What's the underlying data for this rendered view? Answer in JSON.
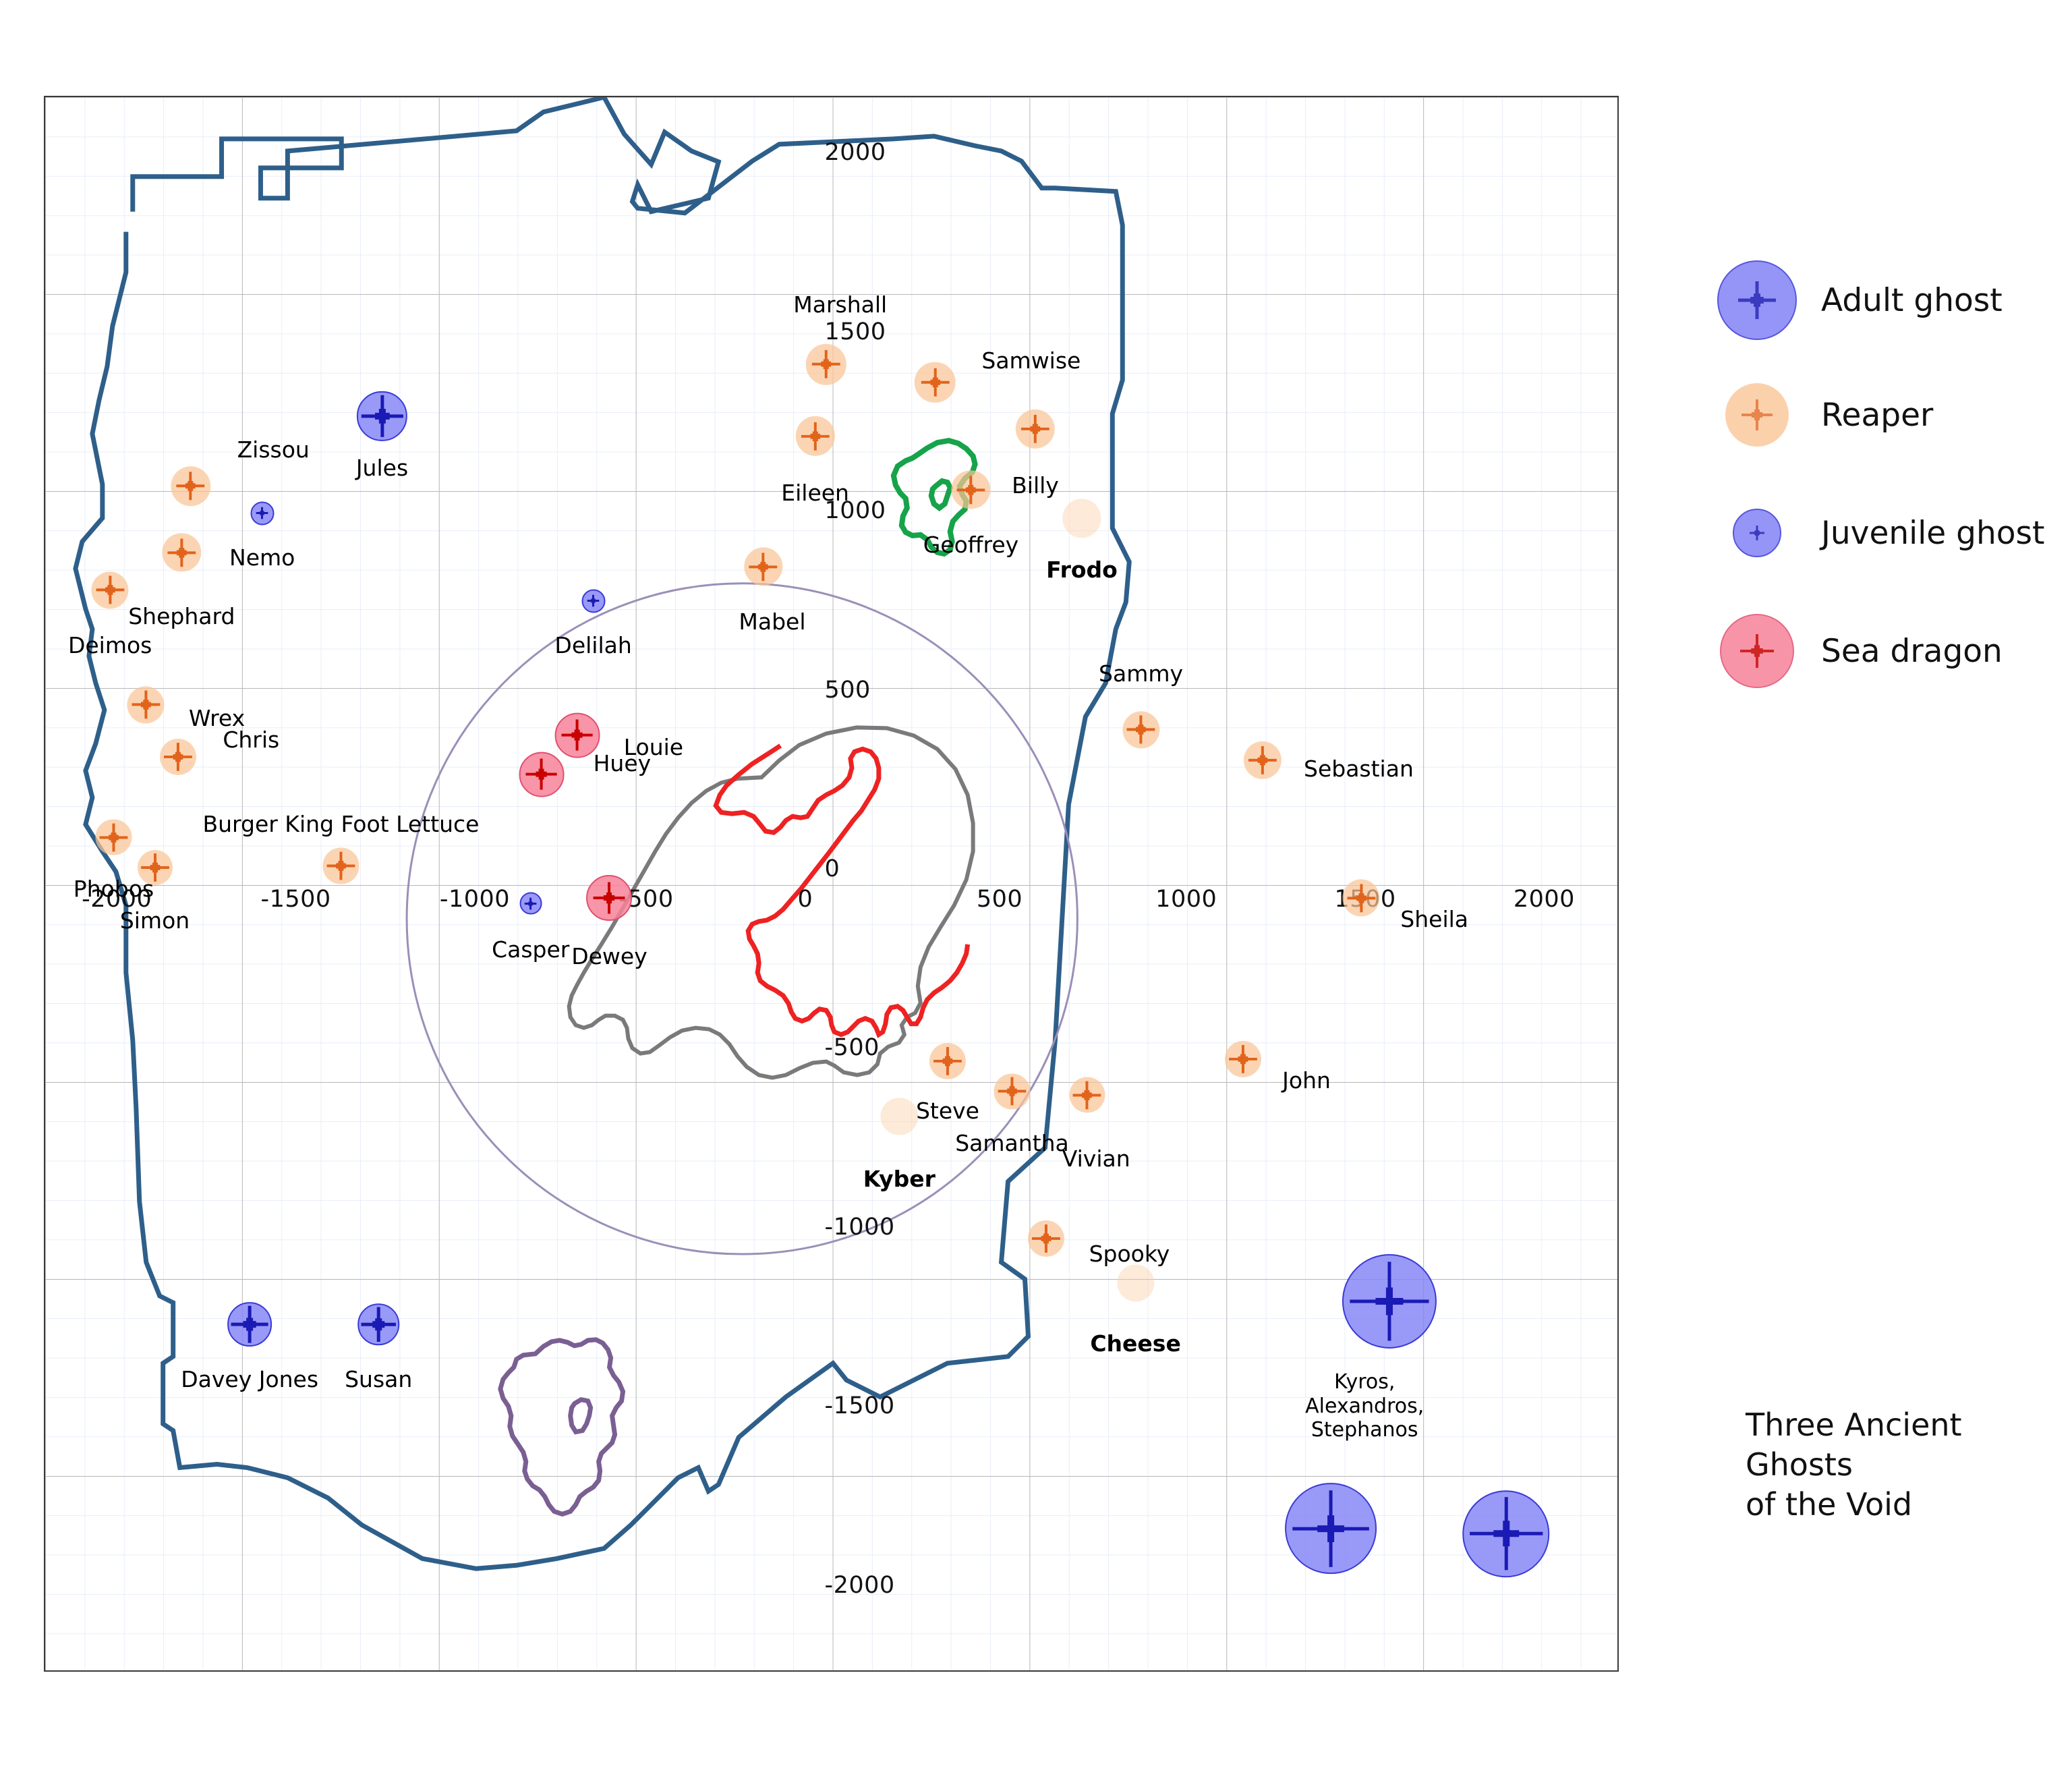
{
  "axes": {
    "x_ticks": [
      {
        "v": -2000,
        "label": "-2000"
      },
      {
        "v": -1500,
        "label": "-1500"
      },
      {
        "v": -1000,
        "label": "-1000"
      },
      {
        "v": -500,
        "label": "-500"
      },
      {
        "v": 0,
        "label": "0"
      },
      {
        "v": 500,
        "label": "500"
      },
      {
        "v": 1000,
        "label": "1000"
      },
      {
        "v": 1500,
        "label": "1500"
      },
      {
        "v": 2000,
        "label": "2000"
      }
    ],
    "y_ticks": [
      {
        "v": 2000,
        "label": "2000"
      },
      {
        "v": 1500,
        "label": "1500"
      },
      {
        "v": 1000,
        "label": "1000"
      },
      {
        "v": 500,
        "label": "500"
      },
      {
        "v": 0,
        "label": "0"
      },
      {
        "v": -500,
        "label": "-500"
      },
      {
        "v": -1000,
        "label": "-1000"
      },
      {
        "v": -1500,
        "label": "-1500"
      },
      {
        "v": -2000,
        "label": "-2000"
      }
    ],
    "xlim": [
      -2200,
      2200
    ],
    "ylim": [
      -2200,
      2200
    ],
    "grid": true
  },
  "legend": {
    "position": "right",
    "items": [
      {
        "label": "Adult ghost",
        "type": "adult",
        "fill": "#8383f7",
        "edge": "#3a3ad6",
        "cross": "#1a1ab4",
        "d": 118,
        "cross_len": 56,
        "cross_w": 5
      },
      {
        "label": "Reaper",
        "type": "reaper",
        "fill": "#fac596",
        "edge": "none",
        "cross": "#e2631b",
        "d": 94,
        "cross_len": 46,
        "cross_w": 4
      },
      {
        "label": "Juvenile ghost",
        "type": "juv",
        "fill": "#8383f7",
        "edge": "#3a3ad6",
        "cross": "#1a1ab4",
        "d": 72,
        "cross_len": 22,
        "cross_w": 3
      },
      {
        "label": "Sea dragon",
        "type": "dragon",
        "fill": "#f78299",
        "edge": "#e05070",
        "cross": "#c80000",
        "d": 110,
        "cross_len": 50,
        "cross_w": 4
      }
    ]
  },
  "annotations": {
    "void_note": "Three Ancient Ghosts\nof the Void"
  },
  "chart_data": {
    "type": "scatter",
    "title": "",
    "xlabel": "",
    "ylabel": "",
    "xlim": [
      -2200,
      2200
    ],
    "ylim": [
      -2200,
      2200
    ],
    "series": [
      {
        "name": "Adult ghost",
        "type": "adult",
        "points": [
          {
            "name": "Jules",
            "x": -1255,
            "y": 1305,
            "r": 70,
            "lx": -1255,
            "ly": 1155,
            "align": "center"
          },
          {
            "name": "Davey Jones",
            "x": -1625,
            "y": -1230,
            "r": 62,
            "lx": -1625,
            "ly": -1390,
            "align": "center"
          },
          {
            "name": "Susan",
            "x": -1265,
            "y": -1230,
            "r": 58,
            "lx": -1265,
            "ly": -1390,
            "align": "center"
          },
          {
            "name": "Kyros, Alexandros, Stephanos",
            "x": 1560,
            "y": -1165,
            "r": 132,
            "lx": 1490,
            "ly": -1400,
            "align": "center",
            "small": true,
            "multiline": "Kyros,\nAlexandros,\nStephanos"
          },
          {
            "name": "",
            "x": 1395,
            "y": -1800,
            "r": 128,
            "lx": 0,
            "ly": 0,
            "nolabel": true
          },
          {
            "name": "",
            "x": 1885,
            "y": -1815,
            "r": 122,
            "lx": 0,
            "ly": 0,
            "nolabel": true
          }
        ]
      },
      {
        "name": "Juvenile ghost",
        "type": "juv",
        "points": [
          {
            "name": "Nemo",
            "x": -1590,
            "y": 1035,
            "r": 33,
            "lx": -1590,
            "ly": 905,
            "align": "center"
          },
          {
            "name": "Delilah",
            "x": -665,
            "y": 790,
            "r": 33,
            "lx": -665,
            "ly": 660,
            "align": "center"
          },
          {
            "name": "Casper",
            "x": -840,
            "y": -55,
            "r": 31,
            "lx": -840,
            "ly": -190,
            "align": "center"
          }
        ]
      },
      {
        "name": "Reaper",
        "type": "reaper",
        "points": [
          {
            "name": "Zissou",
            "x": -1790,
            "y": 1110,
            "r": 56,
            "lx": -1660,
            "ly": 1205,
            "align": "left"
          },
          {
            "name": "Shephard",
            "x": -1815,
            "y": 925,
            "r": 54,
            "lx": -1815,
            "ly": 740,
            "align": "center"
          },
          {
            "name": "Deimos",
            "x": -2015,
            "y": 820,
            "r": 52,
            "lx": -2015,
            "ly": 660,
            "align": "center"
          },
          {
            "name": "Wrex",
            "x": -1915,
            "y": 500,
            "r": 52,
            "lx": -1795,
            "ly": 455,
            "align": "left"
          },
          {
            "name": "Chris",
            "x": -1825,
            "y": 355,
            "r": 51,
            "lx": -1700,
            "ly": 395,
            "align": "left"
          },
          {
            "name": "Phobos",
            "x": -2005,
            "y": 130,
            "r": 50,
            "lx": -2005,
            "ly": -20,
            "align": "center"
          },
          {
            "name": "Simon",
            "x": -1890,
            "y": 45,
            "r": 49,
            "lx": -1890,
            "ly": -110,
            "align": "center"
          },
          {
            "name": "Burger King Foot Lettuce",
            "x": -1370,
            "y": 50,
            "r": 50,
            "lx": -1370,
            "ly": 160,
            "align": "center"
          },
          {
            "name": "Marshall",
            "x": -15,
            "y": 1450,
            "r": 57,
            "lx": 25,
            "ly": 1610,
            "align": "center"
          },
          {
            "name": "Samwise",
            "x": 290,
            "y": 1400,
            "r": 57,
            "lx": 420,
            "ly": 1455,
            "align": "left"
          },
          {
            "name": "Eileen",
            "x": -45,
            "y": 1250,
            "r": 55,
            "lx": -45,
            "ly": 1085,
            "align": "center"
          },
          {
            "name": "Billy",
            "x": 570,
            "y": 1270,
            "r": 55,
            "lx": 570,
            "ly": 1105,
            "align": "center"
          },
          {
            "name": "Geoffrey",
            "x": 390,
            "y": 1100,
            "r": 54,
            "lx": 390,
            "ly": 940,
            "align": "center"
          },
          {
            "name": "Frodo",
            "x": 700,
            "y": 1020,
            "r": 54,
            "lx": 700,
            "ly": 870,
            "align": "center",
            "faded": true,
            "bold": true
          },
          {
            "name": "Mabel",
            "x": -190,
            "y": 885,
            "r": 54,
            "lx": -165,
            "ly": 725,
            "align": "center"
          },
          {
            "name": "Sammy",
            "x": 865,
            "y": 430,
            "r": 52,
            "lx": 865,
            "ly": 580,
            "align": "center"
          },
          {
            "name": "Sebastian",
            "x": 1205,
            "y": 345,
            "r": 53,
            "lx": 1320,
            "ly": 315,
            "align": "left"
          },
          {
            "name": "Sheila",
            "x": 1480,
            "y": -40,
            "r": 52,
            "lx": 1590,
            "ly": -105,
            "align": "left"
          },
          {
            "name": "Steve",
            "x": 325,
            "y": -495,
            "r": 51,
            "lx": 325,
            "ly": -640,
            "align": "center"
          },
          {
            "name": "Samantha",
            "x": 505,
            "y": -580,
            "r": 50,
            "lx": 505,
            "ly": -730,
            "align": "center"
          },
          {
            "name": "Vivian",
            "x": 715,
            "y": -590,
            "r": 50,
            "lx": 740,
            "ly": -775,
            "align": "center"
          },
          {
            "name": "John",
            "x": 1150,
            "y": -490,
            "r": 51,
            "lx": 1260,
            "ly": -555,
            "align": "left"
          },
          {
            "name": "Kyber",
            "x": 190,
            "y": -650,
            "r": 52,
            "lx": 190,
            "ly": -830,
            "align": "center",
            "faded": true,
            "bold": true
          },
          {
            "name": "Spooky",
            "x": 600,
            "y": -990,
            "r": 51,
            "lx": 720,
            "ly": -1040,
            "align": "left"
          },
          {
            "name": "Cheese",
            "x": 850,
            "y": -1115,
            "r": 52,
            "lx": 850,
            "ly": -1290,
            "align": "center",
            "faded": true,
            "bold": true
          }
        ]
      },
      {
        "name": "Sea dragon",
        "type": "dragon",
        "points": [
          {
            "name": "Louie",
            "x": -710,
            "y": 415,
            "r": 63,
            "lx": -580,
            "ly": 375,
            "align": "left"
          },
          {
            "name": "Huey",
            "x": -810,
            "y": 305,
            "r": 63,
            "lx": -665,
            "ly": 330,
            "align": "left"
          },
          {
            "name": "Dewey",
            "x": -620,
            "y": -40,
            "r": 64,
            "lx": -620,
            "ly": -210,
            "align": "center"
          }
        ]
      }
    ]
  }
}
